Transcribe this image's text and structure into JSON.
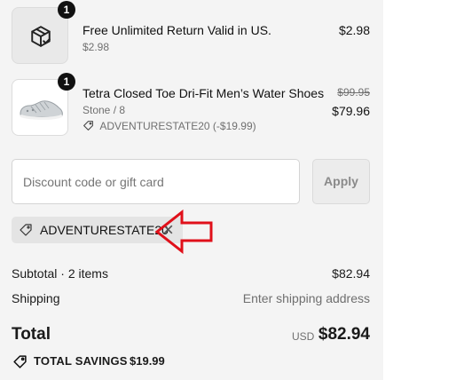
{
  "items": [
    {
      "title": "Free Unlimited Return Valid in US.",
      "subtitle": "$2.98",
      "price": "$2.98",
      "quantity": "1",
      "icon": "package-check-icon"
    },
    {
      "title": "Tetra Closed Toe Dri-Fit Men’s Water Shoes",
      "variant": "Stone / 8",
      "discount": "ADVENTURESTATE20 (-$19.99)",
      "compare_price": "$99.95",
      "price": "$79.96",
      "quantity": "1",
      "image": "water-shoes-image"
    }
  ],
  "discount_form": {
    "placeholder": "Discount code or gift card",
    "apply_label": "Apply"
  },
  "applied_code": "ADVENTURESTATE20",
  "summary": {
    "subtotal_label": "Subtotal · 2 items",
    "subtotal_value": "$82.94",
    "shipping_label": "Shipping",
    "shipping_value": "Enter shipping address",
    "total_label": "Total",
    "currency": "USD",
    "total_value": "$82.94",
    "savings_label": "TOTAL SAVINGS",
    "savings_value": "$19.99"
  },
  "colors": {
    "panel_bg": "#f4f4f4",
    "annotation_arrow": "#e0101a"
  }
}
